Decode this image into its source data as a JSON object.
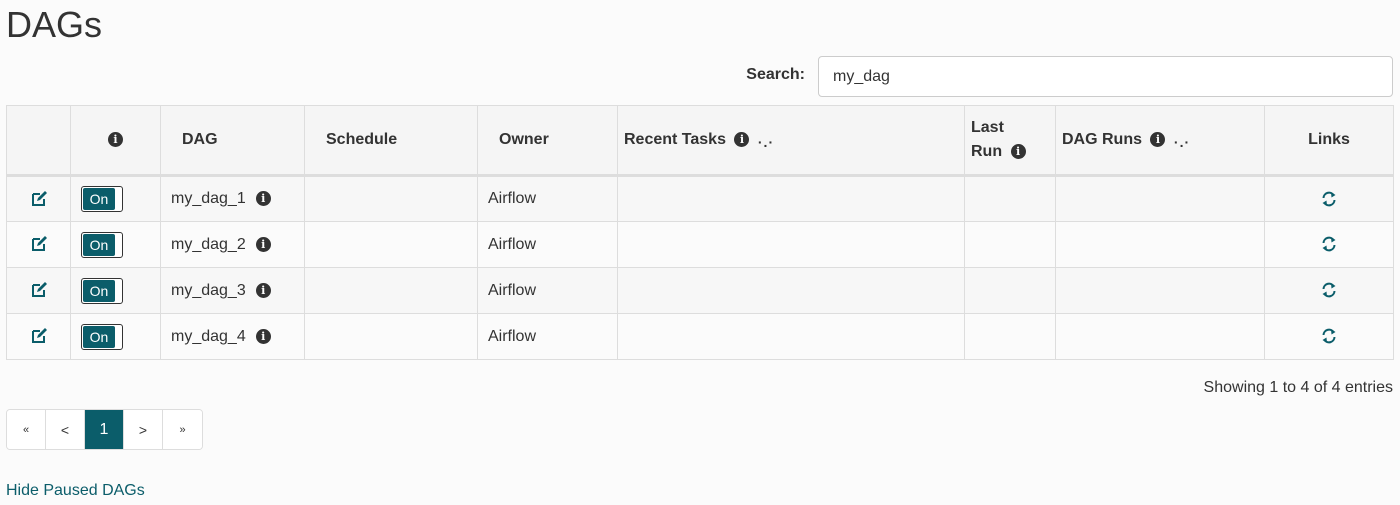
{
  "page": {
    "title": "DAGs"
  },
  "search": {
    "label": "Search:",
    "value": "my_dag"
  },
  "table": {
    "headers": {
      "dag": "DAG",
      "schedule": "Schedule",
      "owner": "Owner",
      "recent_tasks": "Recent Tasks",
      "last_run_1": "Last",
      "last_run_2": "Run",
      "dag_runs": "DAG Runs",
      "links": "Links",
      "loading": "·.·"
    },
    "rows": [
      {
        "dag": "my_dag_1",
        "toggle": "On",
        "owner": "Airflow",
        "schedule": "",
        "recent_tasks": "",
        "last_run": "",
        "dag_runs": ""
      },
      {
        "dag": "my_dag_2",
        "toggle": "On",
        "owner": "Airflow",
        "schedule": "",
        "recent_tasks": "",
        "last_run": "",
        "dag_runs": ""
      },
      {
        "dag": "my_dag_3",
        "toggle": "On",
        "owner": "Airflow",
        "schedule": "",
        "recent_tasks": "",
        "last_run": "",
        "dag_runs": ""
      },
      {
        "dag": "my_dag_4",
        "toggle": "On",
        "owner": "Airflow",
        "schedule": "",
        "recent_tasks": "",
        "last_run": "",
        "dag_runs": ""
      }
    ]
  },
  "footer": {
    "showing": "Showing 1 to 4 of 4 entries",
    "pagination": {
      "first": "«",
      "prev": "<",
      "current": "1",
      "next": ">",
      "last": "»"
    },
    "hide_paused": "Hide Paused DAGs"
  },
  "icons": {
    "info": "info-icon",
    "edit": "edit-icon",
    "refresh": "refresh-icon"
  },
  "colors": {
    "accent": "#0b5d6a",
    "text": "#333333",
    "border": "#dddddd"
  }
}
